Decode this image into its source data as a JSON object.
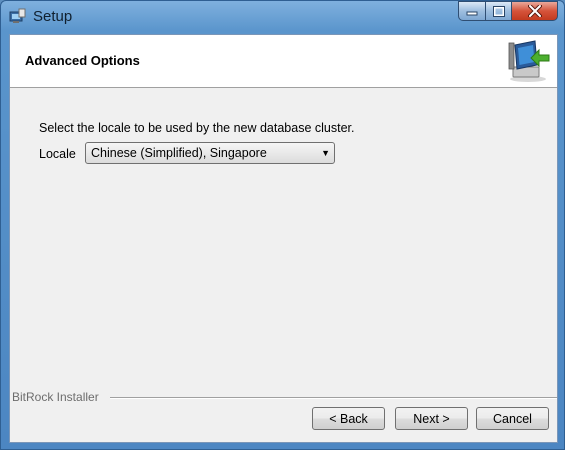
{
  "window": {
    "title": "Setup"
  },
  "header": {
    "title": "Advanced Options",
    "image": "install-computer-icon"
  },
  "content": {
    "description": "Select the locale to be used by the new database cluster.",
    "locale": {
      "label": "Locale",
      "selected": "Chinese (Simplified), Singapore"
    }
  },
  "footer": {
    "brand": "BitRock Installer",
    "back_label": "< Back",
    "next_label": "Next >",
    "cancel_label": "Cancel"
  },
  "icons": {
    "app": "setup-app-icon",
    "minimize": "minimize-icon",
    "maximize": "maximize-icon",
    "close": "close-icon",
    "dropdown": "chevron-down-icon"
  },
  "colors": {
    "title_bar": "#5a95cc",
    "close_button": "#d5533a",
    "client_bg": "#f0f0f0"
  }
}
